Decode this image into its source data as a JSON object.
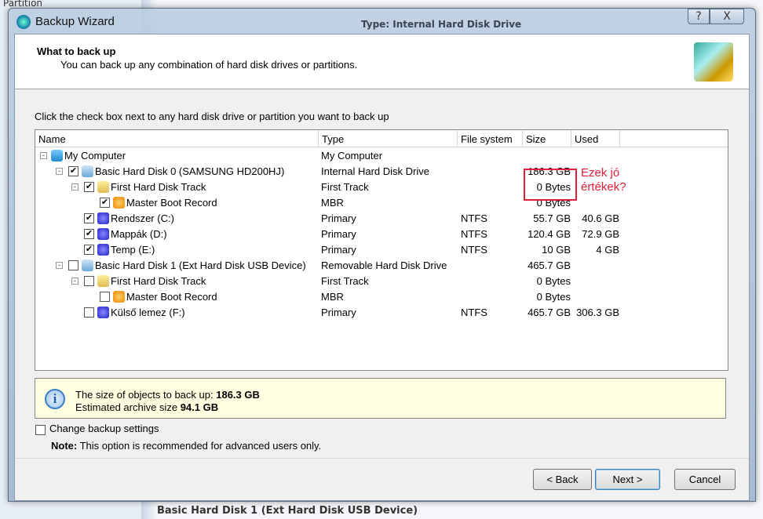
{
  "background": {
    "sidebar_item": "Partition",
    "detail_header": "Type: Internal Hard Disk Drive",
    "bottom_text": "Basic Hard Disk 1 (Ext Hard  Disk USB Device)"
  },
  "window": {
    "title": "Backup Wizard",
    "help": "?",
    "close": "X"
  },
  "header": {
    "title": "What to back up",
    "subtitle": "You can back up any combination of hard disk drives or partitions."
  },
  "instruction": "Click the check box next to any hard disk drive or partition you want to back up",
  "columns": [
    "Name",
    "Type",
    "File system",
    "Size",
    "Used"
  ],
  "rows": [
    {
      "name": "My Computer",
      "type": "My Computer",
      "fs": "",
      "size": "",
      "used": "",
      "level": 0,
      "checkbox": null,
      "icon": "computer-icon"
    },
    {
      "name": "Basic Hard Disk 0 (SAMSUNG HD200HJ)",
      "type": "Internal Hard Disk Drive",
      "fs": "",
      "size": "186.3 GB",
      "used": "",
      "level": 1,
      "checkbox": true,
      "icon": "hard-disk-icon"
    },
    {
      "name": "First Hard Disk Track",
      "type": "First Track",
      "fs": "",
      "size": "0 Bytes",
      "used": "",
      "level": 2,
      "checkbox": true,
      "icon": "track-icon"
    },
    {
      "name": "Master Boot Record",
      "type": "MBR",
      "fs": "",
      "size": "0 Bytes",
      "used": "",
      "level": 3,
      "checkbox": true,
      "icon": "mbr-icon"
    },
    {
      "name": "Rendszer (C:)",
      "type": "Primary",
      "fs": "NTFS",
      "size": "55.7 GB",
      "used": "40.6 GB",
      "level": 2,
      "checkbox": true,
      "icon": "partition-icon"
    },
    {
      "name": "Mappák (D:)",
      "type": "Primary",
      "fs": "NTFS",
      "size": "120.4 GB",
      "used": "72.9 GB",
      "level": 2,
      "checkbox": true,
      "icon": "partition-icon"
    },
    {
      "name": "Temp (E:)",
      "type": "Primary",
      "fs": "NTFS",
      "size": "10 GB",
      "used": "4 GB",
      "level": 2,
      "checkbox": true,
      "icon": "partition-icon"
    },
    {
      "name": "Basic Hard Disk 1 (Ext Hard  Disk USB Device)",
      "type": "Removable Hard Disk Drive",
      "fs": "",
      "size": "465.7 GB",
      "used": "",
      "level": 1,
      "checkbox": false,
      "icon": "hard-disk-icon"
    },
    {
      "name": "First Hard Disk Track",
      "type": "First Track",
      "fs": "",
      "size": "0 Bytes",
      "used": "",
      "level": 2,
      "checkbox": false,
      "icon": "track-icon"
    },
    {
      "name": "Master Boot Record",
      "type": "MBR",
      "fs": "",
      "size": "0 Bytes",
      "used": "",
      "level": 3,
      "checkbox": false,
      "icon": "mbr-icon"
    },
    {
      "name": "Külső lemez (F:)",
      "type": "Primary",
      "fs": "NTFS",
      "size": "465.7 GB",
      "used": "306.3 GB",
      "level": 2,
      "checkbox": false,
      "icon": "partition-icon"
    }
  ],
  "info": {
    "size_label": "The size of objects to back up:",
    "size_value": "186.3 GB",
    "archive_label": "Estimated archive size",
    "archive_value": "94.1 GB"
  },
  "settings": {
    "checkbox_label": "Change backup settings",
    "checked": false,
    "note_bold": "Note:",
    "note_text": "This option is recommended for advanced users only."
  },
  "buttons": {
    "back": "< Back",
    "next": "Next >",
    "cancel": "Cancel"
  },
  "annotation": {
    "text_line1": "Ezek jó",
    "text_line2": "értékek?",
    "color": "#e0203a"
  }
}
